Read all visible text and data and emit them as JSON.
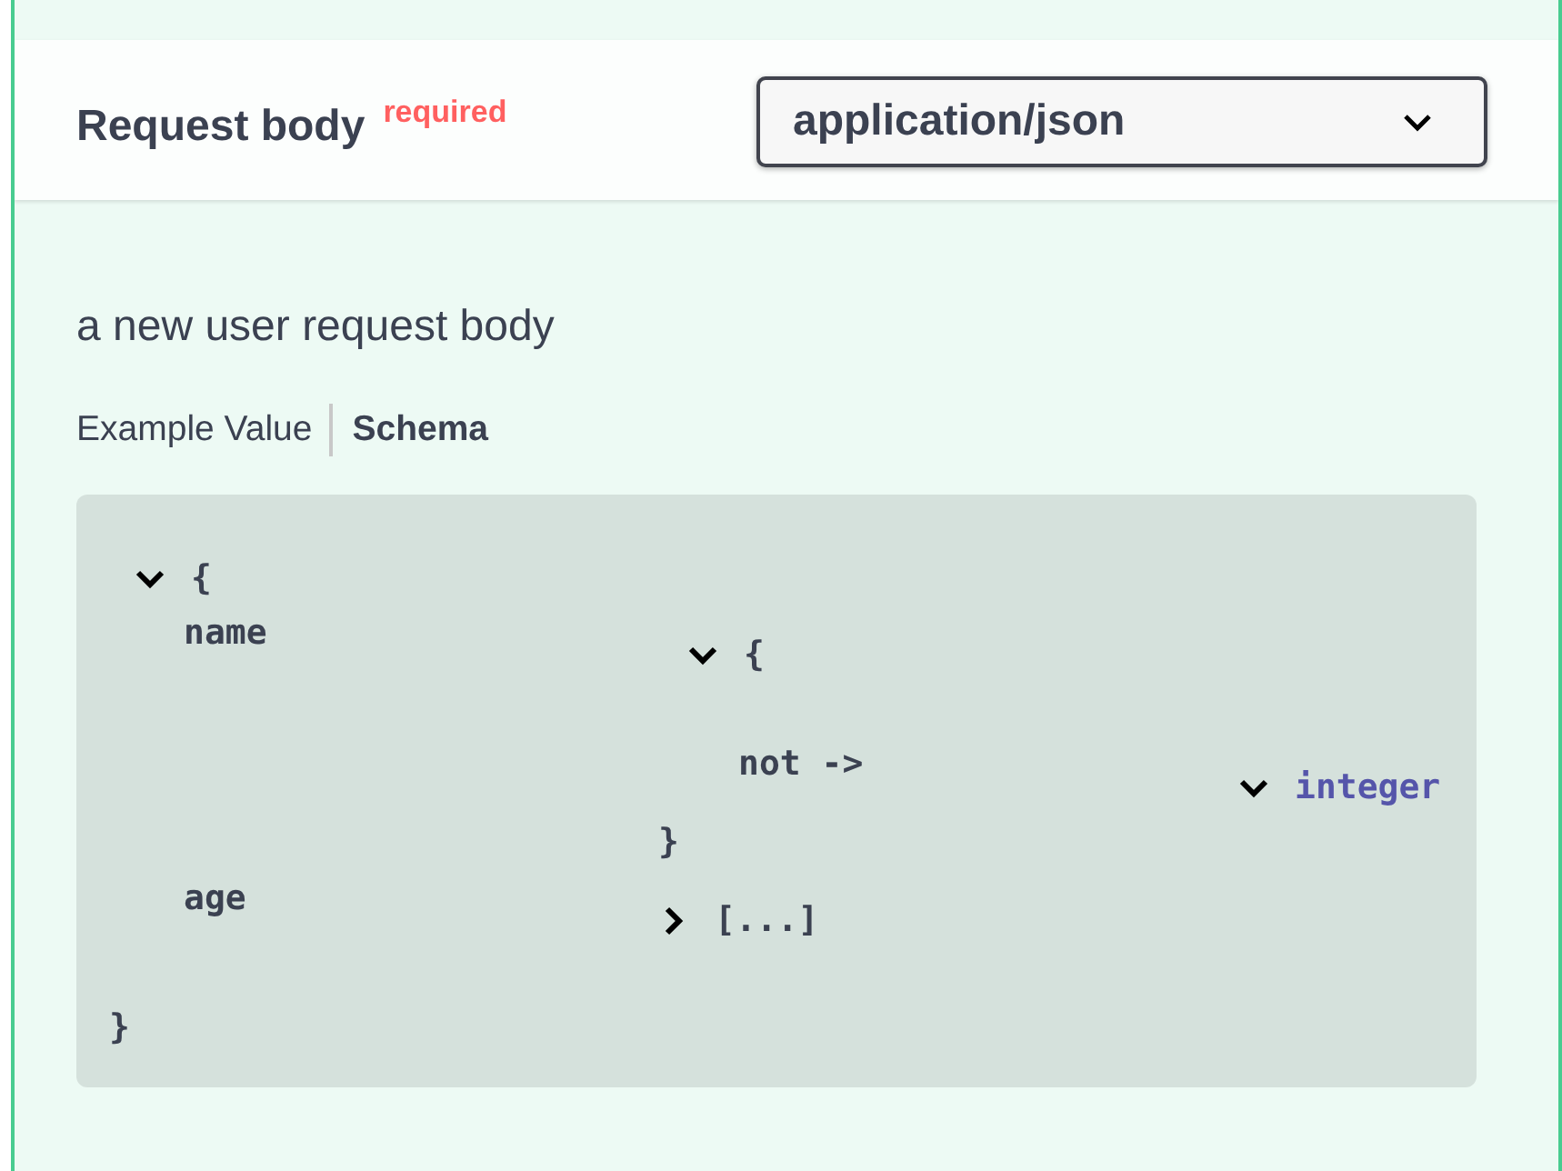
{
  "section_header": {
    "title": "Request body",
    "required_label": "required",
    "content_type": "application/json"
  },
  "description": "a new user request body",
  "tabs": [
    {
      "label": "Example Value",
      "selected": false
    },
    {
      "label": "Schema",
      "selected": true
    }
  ],
  "schema": {
    "kind": "object",
    "expanded": true,
    "open_brace": "{",
    "close_brace": "}",
    "properties": [
      {
        "name": "name",
        "value": {
          "kind": "object",
          "expanded": true,
          "open_brace": "{",
          "close_brace": "}",
          "properties": [
            {
              "name": "not ->",
              "value": {
                "kind": "primitive",
                "expanded": true,
                "type": "integer"
              }
            }
          ]
        }
      },
      {
        "name": "age",
        "value": {
          "kind": "array",
          "expanded": false,
          "collapsed_text": "[...]"
        }
      }
    ]
  }
}
